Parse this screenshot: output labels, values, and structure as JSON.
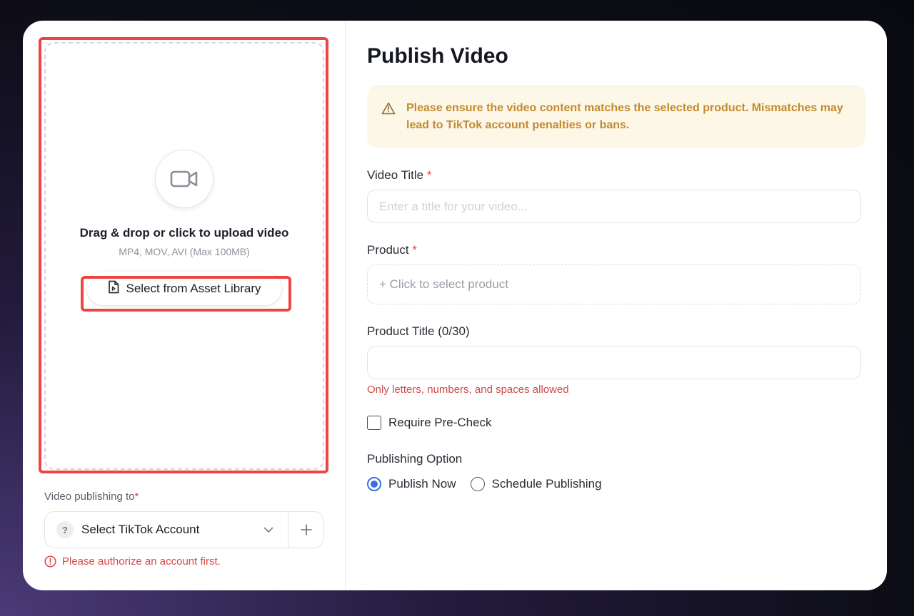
{
  "upload": {
    "title": "Drag & drop or click to upload video",
    "subtitle": "MP4, MOV, AVI (Max 100MB)",
    "asset_button_label": "Select from Asset Library",
    "icon": "video-camera-icon"
  },
  "account": {
    "label": "Video publishing to",
    "required_mark": "*",
    "select_placeholder": "Select TikTok Account",
    "error": "Please authorize an account first."
  },
  "form": {
    "title": "Publish Video",
    "alert_text": "Please ensure the video content matches the selected product. Mismatches may lead to TikTok account penalties or bans.",
    "video_title_label": "Video Title",
    "video_title_placeholder": "Enter a title for your video...",
    "video_title_value": "",
    "required_mark": "*",
    "product_label": "Product",
    "product_select_text": "+ Click to select product",
    "product_title_label": "Product Title (0/30)",
    "product_title_value": "",
    "product_title_hint": "Only letters, numbers, and spaces allowed",
    "precheck_label": "Require Pre-Check",
    "precheck_checked": false,
    "publishing_option_label": "Publishing Option",
    "publishing_options": [
      "Publish Now",
      "Schedule Publishing"
    ],
    "publishing_selected": "Publish Now"
  },
  "colors": {
    "highlight": "#ee4444",
    "accent": "#3b6fe0",
    "alert_bg": "#fdf7e8",
    "alert_text": "#c38a2e",
    "error": "#d94646"
  }
}
